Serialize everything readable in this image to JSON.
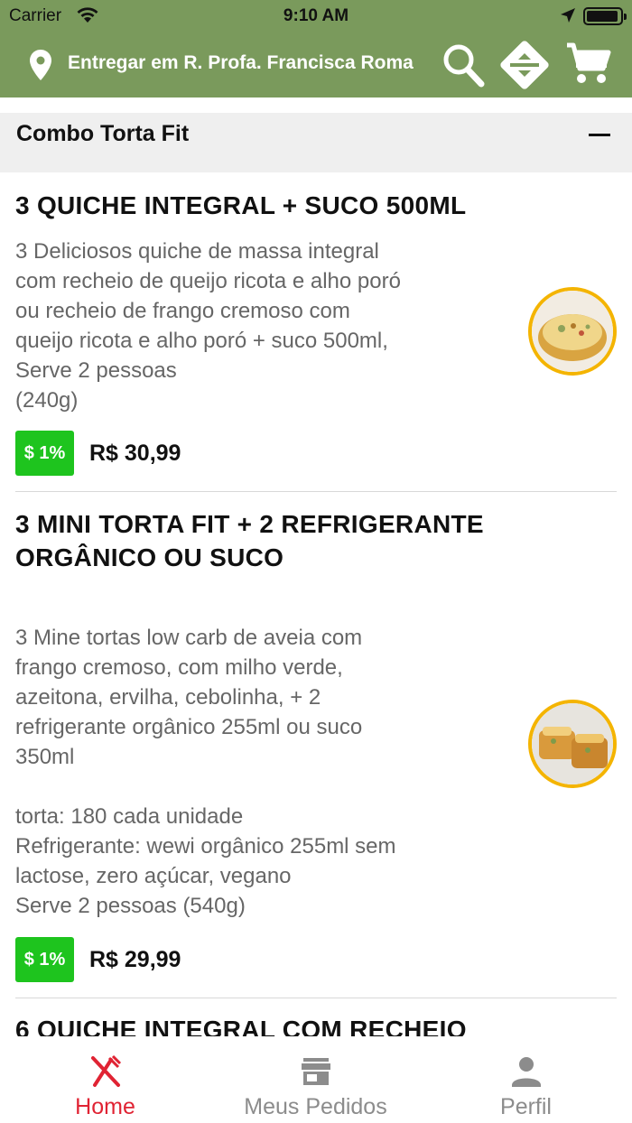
{
  "status_bar": {
    "carrier": "Carrier",
    "time": "9:10 AM"
  },
  "header": {
    "address": "Entregar em R. Profa. Francisca Roma",
    "icons": [
      "location-pin-icon",
      "search-icon",
      "filter-icon",
      "cart-icon"
    ],
    "background_color": "#7a9a5c"
  },
  "section": {
    "title": "Combo Torta Fit",
    "collapse_symbol": "−"
  },
  "items": [
    {
      "name": "3 QUICHE INTEGRAL + SUCO 500ML",
      "description": "3 Deliciosos quiche de massa integral\ncom recheio de queijo ricota e alho poró\nou recheio de frango cremoso com\nqueijo ricota e alho poró + suco 500ml,\nServe 2 pessoas\n(240g)",
      "badge": "$ 1%",
      "price": "R$ 30,99"
    },
    {
      "name": "3 MINI TORTA FIT + 2 REFRIGERANTE ORGÂNICO OU SUCO",
      "description": "3 Mine tortas low carb de aveia com\nfrango cremoso, com milho verde,\nazeitona, ervilha, cebolinha, + 2\nrefrigerante orgânico 255ml ou suco\n350ml\n\ntorta: 180 cada unidade\nRefrigerante: wewi orgânico 255ml sem\nlactose, zero açúcar, vegano\nServe 2 pessoas (540g)",
      "badge": "$ 1%",
      "price": "R$ 29,99"
    },
    {
      "name": "6 QUICHE INTEGRAL COM RECHEIO"
    }
  ],
  "tabbar": {
    "tabs": [
      {
        "label": "Home",
        "active": true
      },
      {
        "label": "Meus Pedidos",
        "active": false
      },
      {
        "label": "Perfil",
        "active": false
      }
    ],
    "active_color": "#e02333",
    "inactive_color": "#8c8c8c"
  }
}
